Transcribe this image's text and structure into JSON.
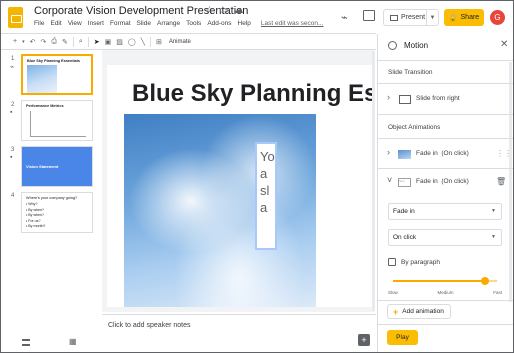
{
  "app": {
    "title": "Corporate Vision Development Presentation",
    "star_icon": "star-icon",
    "folder_icon": "folder-icon",
    "cloud_icon": "cloud-icon"
  },
  "menu": {
    "items": [
      "File",
      "Edit",
      "View",
      "Insert",
      "Format",
      "Slide",
      "Arrange",
      "Tools",
      "Add-ons",
      "Help"
    ],
    "last_edit": "Last edit was secon..."
  },
  "header": {
    "present_label": "Present",
    "share_label": "Share",
    "avatar_letter": "G"
  },
  "toolbar": {
    "animate_label": "Animate"
  },
  "filmstrip": {
    "slides": [
      {
        "number": "1",
        "title": "Blue Sky Planning Essentials"
      },
      {
        "number": "2",
        "title": "Performance Metrics"
      },
      {
        "number": "3",
        "title": "Vision Statement"
      },
      {
        "number": "4",
        "title": "Where's your company going?",
        "bullets": [
          "• Why?",
          "• By when?",
          "• By when?",
          "• For us?",
          "• By month?"
        ]
      }
    ]
  },
  "slide": {
    "title": "Blue Sky Planning Es",
    "textbox_lines": [
      "Yo",
      "a",
      "sl",
      "a"
    ]
  },
  "notes": {
    "placeholder": "Click to add speaker notes"
  },
  "panel": {
    "title": "Motion",
    "slide_transition_label": "Slide Transition",
    "transition_value": "Slide from right",
    "object_animations_label": "Object Animations",
    "animations": [
      {
        "label": "Fade in",
        "trigger": "(On click)"
      },
      {
        "label": "Fade in",
        "trigger": "(On click)"
      }
    ],
    "effect_select": "Fade in",
    "trigger_select": "On click",
    "by_paragraph_label": "By paragraph",
    "speed_labels": [
      "Slow",
      "Medium",
      "Fast"
    ],
    "speed_level": 0.88,
    "add_animation_label": "Add animation",
    "play_label": "Play"
  },
  "colors": {
    "accent": "#fbbc04",
    "selection": "#f9ab00",
    "slide_blue": "#4a86e8"
  }
}
